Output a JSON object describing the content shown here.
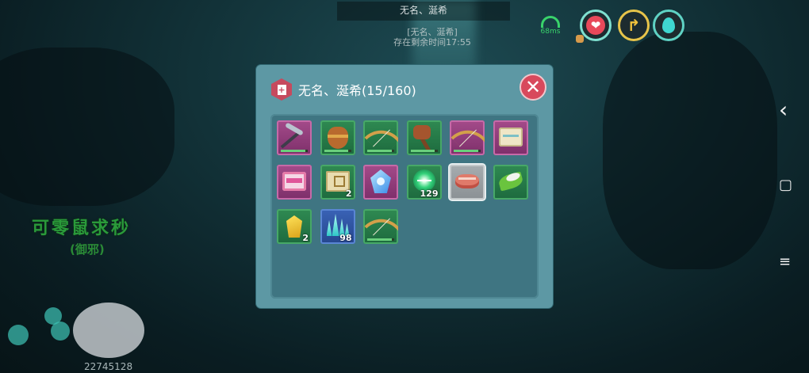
{
  "hud": {
    "top_name": "无名、涎希",
    "top_sub_name": "[无名、涎希]",
    "top_sub_info": "存在剩余时间17:55",
    "network_label": "68ms",
    "buttons": {
      "heart_glyph": "❤",
      "turn_glyph": "↱"
    }
  },
  "system_nav": {
    "back": "‹",
    "home": "▢",
    "menu": "≡"
  },
  "world": {
    "npc_name": "可零鼠求秒",
    "npc_sub": "(御邪)",
    "player_id": "22745128"
  },
  "inventory": {
    "title": "无名、涎希(15/160)",
    "close_glyph": "✕",
    "bag_glyph": "+",
    "items": [
      {
        "icon": "pickaxe-icon",
        "rarity": "purple",
        "durability": 0.9
      },
      {
        "icon": "boot-icon",
        "rarity": "green",
        "durability": 0.9
      },
      {
        "icon": "bow-icon",
        "rarity": "green",
        "durability": 0.9
      },
      {
        "icon": "axe-icon",
        "rarity": "green",
        "durability": 0.9
      },
      {
        "icon": "bow-icon",
        "rarity": "purple",
        "durability": 0.9
      },
      {
        "icon": "scroll-icon",
        "rarity": "purple"
      },
      {
        "icon": "pink-scroll-icon",
        "rarity": "purple"
      },
      {
        "icon": "map-icon",
        "rarity": "green",
        "qty": "2"
      },
      {
        "icon": "crystal-icon",
        "rarity": "purple"
      },
      {
        "icon": "green-orb-icon",
        "rarity": "green",
        "qty": "129"
      },
      {
        "icon": "meat-icon",
        "rarity": "grey",
        "selected": true
      },
      {
        "icon": "leaf-icon",
        "rarity": "green"
      },
      {
        "icon": "yellow-gem-icon",
        "rarity": "green",
        "qty": "2"
      },
      {
        "icon": "ice-shard-icon",
        "rarity": "blue",
        "qty": "98"
      },
      {
        "icon": "bow-icon",
        "rarity": "green",
        "durability": 0.9
      }
    ]
  }
}
